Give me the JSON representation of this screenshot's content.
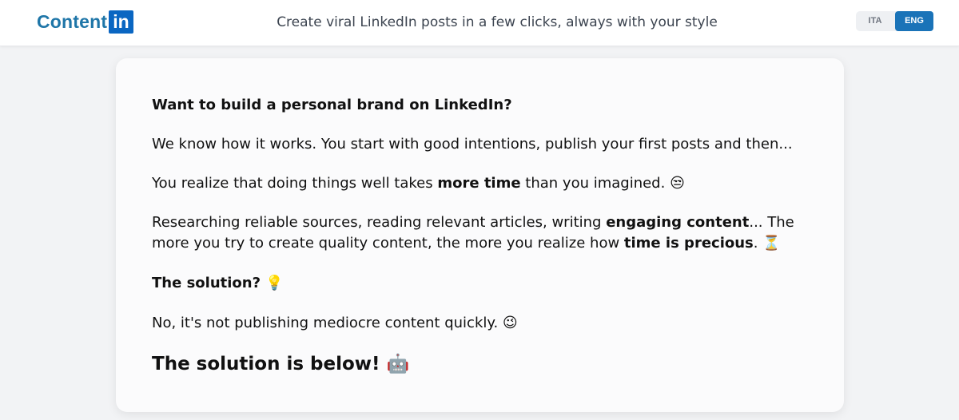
{
  "header": {
    "logo_text": "Content",
    "logo_badge": "in",
    "tagline": "Create viral LinkedIn posts in a few clicks, always with your style",
    "languages": [
      {
        "label": "ITA",
        "active": false
      },
      {
        "label": "ENG",
        "active": true
      }
    ]
  },
  "content": {
    "heading": "Want to build a personal brand on LinkedIn?",
    "p1": "We know how it works. You start with good intentions, publish your first posts and then...",
    "p2_pre": "You realize that doing things well takes ",
    "p2_bold": "more time",
    "p2_post": " than you imagined.",
    "p2_emoji": "😒",
    "p3_a": "Researching reliable sources, reading relevant articles, writing ",
    "p3_bold1": "engaging content",
    "p3_b": "... The more you try to create quality content, the more you realize how ",
    "p3_bold2": "time is precious",
    "p3_c": ".",
    "p3_emoji": "⏳",
    "solution_q": "The solution?",
    "solution_emoji": "💡",
    "p5": "No, it's not publishing mediocre content quickly.",
    "p5_emoji": "😉",
    "final": "The solution is below!",
    "final_emoji": "🤖"
  }
}
